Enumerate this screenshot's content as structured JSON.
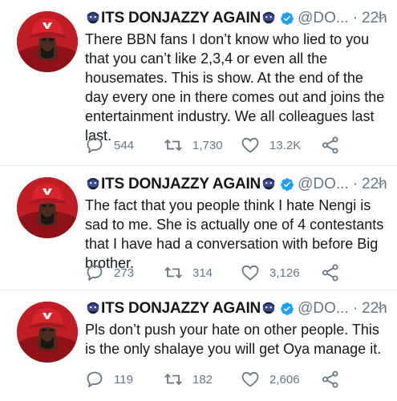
{
  "tweets": [
    {
      "name": "ITS DONJAZZY AGAIN",
      "handle": "@DO...",
      "time": "22h",
      "text": "There BBN fans I don’t know who lied to you that you can’t like 2,3,4 or even all the housemates. This is show. At the end of the day every one in there comes out and joins the entertainment industry. We all colleagues last last.",
      "replies": "544",
      "retweets": "1,730",
      "likes": "13.2K"
    },
    {
      "name": "ITS DONJAZZY AGAIN",
      "handle": "@DO...",
      "time": "22h",
      "text": "The fact that you people think I hate Nengi is sad to me. She is actually one of 4 contestants that I have had a conversation with before Big brother.",
      "replies": "273",
      "retweets": "314",
      "likes": "3,126"
    },
    {
      "name": "ITS DONJAZZY AGAIN",
      "handle": "@DO...",
      "time": "22h",
      "text": "Pls don’t push your hate on other people. This is the only shalaye you will get Oya manage it.",
      "replies": "119",
      "retweets": "182",
      "likes": "2,606"
    }
  ],
  "colors": {
    "verified": "#1da1f2",
    "meta": "#657786",
    "text": "#14171a",
    "divider": "#e6ecf0",
    "cap_red": "#c8202a"
  },
  "icons": [
    "bearded-face-emoji-icon",
    "verified-badge-icon",
    "chevron-down-icon",
    "reply-icon",
    "retweet-icon",
    "like-icon",
    "share-icon"
  ]
}
